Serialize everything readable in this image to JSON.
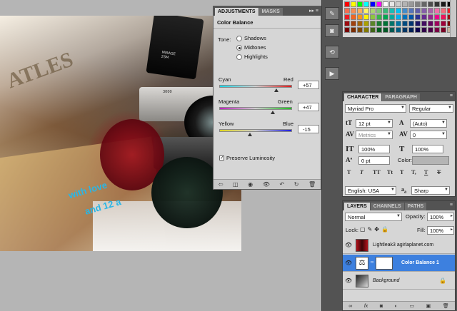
{
  "canvas": {
    "magazine_title": "ATLES",
    "magazine_text_line1": "with love",
    "magazine_text_line2": "and 12 a",
    "camera_label_line1": "MIRAGE",
    "camera_label_line2": "2SM",
    "camera_body_label": "3000"
  },
  "adjustments": {
    "tabs": [
      "ADJUSTMENTS",
      "MASKS"
    ],
    "menu_icon": "panel-menu-icon",
    "title": "Color Balance",
    "tone_label": "Tone:",
    "tone_options": [
      "Shadows",
      "Midtones",
      "Highlights"
    ],
    "tone_selected": "Midtones",
    "sliders": [
      {
        "left": "Cyan",
        "right": "Red",
        "value_text": "+57",
        "value": 57,
        "min": -100,
        "max": 100,
        "gradient": [
          "#1ad6e8",
          "#e31a1a"
        ]
      },
      {
        "left": "Magenta",
        "right": "Green",
        "value_text": "+47",
        "value": 47,
        "min": -100,
        "max": 100,
        "gradient": [
          "#c21fc2",
          "#1fc21f"
        ]
      },
      {
        "left": "Yellow",
        "right": "Blue",
        "value_text": "-15",
        "value": -15,
        "min": -100,
        "max": 100,
        "gradient": [
          "#e0d61c",
          "#1c1ce0"
        ]
      }
    ],
    "preserve_luminosity": "Preserve Luminosity",
    "preserve_checked": true,
    "footer_icons": [
      "return-icon",
      "clip-icon",
      "visibility-icon",
      "eye-icon",
      "reset-icon",
      "refresh-icon",
      "delete-icon"
    ]
  },
  "tools": {
    "icons": [
      "brush-icon",
      "mask-icon",
      "history-icon",
      "play-icon"
    ]
  },
  "swatches": {
    "colors": [
      "#ff0000",
      "#ffff00",
      "#00ff00",
      "#00ffff",
      "#0000ff",
      "#ff00ff",
      "#ffffff",
      "#e6e6e6",
      "#cccccc",
      "#b3b3b3",
      "#999999",
      "#808080",
      "#666666",
      "#4d4d4d",
      "#333333",
      "#1a1a1a",
      "#000000",
      "#f26c4f",
      "#f68e55",
      "#fbaf5c",
      "#fff467",
      "#acd372",
      "#7cc576",
      "#3bb878",
      "#1abbb4",
      "#00bff3",
      "#438ccb",
      "#5574b9",
      "#605ca8",
      "#855fa8",
      "#a763a8",
      "#f06ea9",
      "#f26d7d",
      "#ed1c24",
      "#ed1c24",
      "#f26522",
      "#f7941d",
      "#fff200",
      "#8dc63f",
      "#39b54a",
      "#00a651",
      "#00a99d",
      "#00aeef",
      "#0072bc",
      "#0054a6",
      "#2e3192",
      "#662d91",
      "#92278f",
      "#ec008c",
      "#ed145b",
      "#9e0b0f",
      "#9e0b0f",
      "#a0410d",
      "#a36209",
      "#aba000",
      "#598527",
      "#1a7b30",
      "#007236",
      "#00746b",
      "#0076a3",
      "#004b80",
      "#003471",
      "#1b1464",
      "#440e62",
      "#630460",
      "#9e005d",
      "#9e0039",
      "#790000",
      "#790000",
      "#7b2e00",
      "#7d4900",
      "#827b00",
      "#406618",
      "#005e20",
      "#005826",
      "#005952",
      "#005b7f",
      "#003663",
      "#002157",
      "#0d004c",
      "#32004b",
      "#4b0049",
      "#7b0046",
      "#7a0026",
      "#c7b299"
    ]
  },
  "character": {
    "tabs": [
      "CHARACTER",
      "PARAGRAPH"
    ],
    "font_family": "Myriad Pro",
    "font_style": "Regular",
    "font_size": "12 pt",
    "leading": "(Auto)",
    "kerning": "Metrics",
    "tracking": "0",
    "vertical_scale": "100%",
    "horizontal_scale": "100%",
    "baseline_shift": "0 pt",
    "color_label": "Color:",
    "style_buttons": [
      "T",
      "T",
      "TT",
      "Tt",
      "T",
      "T,",
      "T",
      "T"
    ],
    "language": "English: USA",
    "aa_prefix": "a",
    "anti_alias": "Sharp"
  },
  "layers": {
    "tabs": [
      "LAYERS",
      "CHANNELS",
      "PATHS"
    ],
    "blend_mode": "Normal",
    "opacity_label": "Opacity:",
    "opacity": "100%",
    "lock_label": "Lock:",
    "fill_label": "Fill:",
    "fill": "100%",
    "items": [
      {
        "name": "Lightleak3 agirlaplanet.com",
        "selected": false
      },
      {
        "name": "Color Balance 1",
        "selected": true
      },
      {
        "name": "Background",
        "selected": false
      }
    ],
    "footer_icons": [
      "link-icon",
      "fx-icon",
      "mask-add-icon",
      "adjustment-icon",
      "group-icon",
      "new-layer-icon",
      "delete-icon"
    ]
  }
}
